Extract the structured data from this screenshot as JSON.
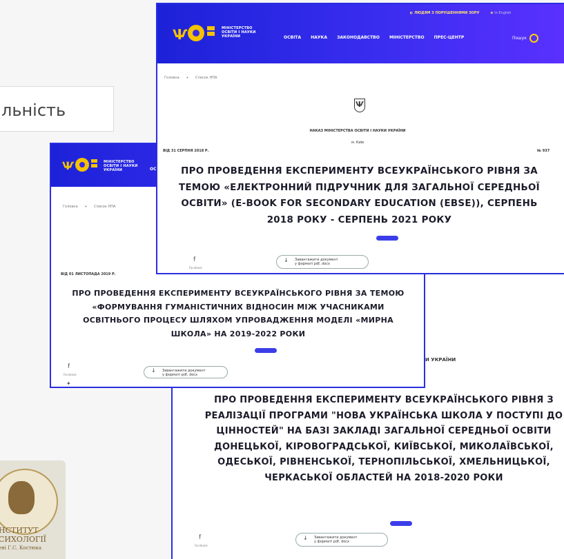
{
  "background": {
    "partial_label": "льність",
    "logo": {
      "line1": "НСТИТУТ",
      "line2": "СИХОЛОГІЇ",
      "line3": "ені Г.С. Костюка"
    }
  },
  "site": {
    "ministry_name": "МІНІСТЕРСТВО ОСВІТИ І НАУКИ УКРАЇНИ",
    "topline": "ЛЮДЯМ З ПОРУШЕННЯМИ ЗОРУ",
    "lang": "In English",
    "nav": [
      "ОСВІТА",
      "НАУКА",
      "ЗАКОНОДАВСТВО",
      "МІНІСТЕРСТВО",
      "ПРЕС-ЦЕНТР"
    ],
    "search_label": "Пошук",
    "crumb_home": "Головна",
    "crumb_sep": "+",
    "crumb_list": "Список НПА",
    "order_label": "НАКАЗ МІНІСТЕРСТВА ОСВІТИ І НАУКИ УКРАЇНИ",
    "city": "м. Київ",
    "download_label": "Завантажити документ",
    "download_sub": "у форматі pdf, docx",
    "facebook": "Facebook"
  },
  "cards": {
    "front": {
      "date": "ВІД 31 СЕРПНЯ 2018 Р.",
      "number": "№ 937",
      "title": "ПРО ПРОВЕДЕННЯ ЕКСПЕРИМЕНТУ ВСЕУКРАЇНСЬКОГО РІВНЯ ЗА ТЕМОЮ «ЕЛЕКТРОННИЙ ПІДРУЧНИК ДЛЯ ЗАГАЛЬНОЇ СЕРЕДНЬОЇ ОСВІТИ» (E-BOOK FOR SECONDARY EDUCATION (EBSE)), СЕРПЕНЬ 2018 РОКУ - СЕРПЕНЬ 2021 РОКУ"
    },
    "middle": {
      "date": "ВІД 01 ЛИСТОПАДА 2019 Р.",
      "title": "ПРО ПРОВЕДЕННЯ ЕКСПЕРИМЕНТУ ВСЕУКРАЇНСЬКОГО РІВНЯ ЗА ТЕМОЮ «ФОРМУВАННЯ ГУМАНІСТИЧНИХ ВІДНОСИН МІЖ УЧАСНИКАМИ ОСВІТНЬОГО ПРОЦЕСУ ШЛЯХОМ УПРОВАДЖЕННЯ МОДЕЛІ «МИРНА ШКОЛА» НА 2019-2022 РОКИ"
    },
    "back": {
      "order_partial": "И УКРАЇНИ",
      "title": "ПРО ПРОВЕДЕННЯ ЕКСПЕРИМЕНТУ ВСЕУКРАЇНСЬКОГО РІВНЯ З РЕАЛІЗАЦІЇ ПРОГРАМИ \"НОВА УКРАЇНСЬКА ШКОЛА У ПОСТУПІ ДО ЦІННОСТЕЙ\" НА БАЗІ ЗАКЛАДІ ЗАГАЛЬНОЇ СЕРЕДНЬОЇ ОСВІТИ ДОНЕЦЬКОЇ, КІРОВОГРАДСЬКОЇ, КИЇВСЬКОЇ, МИКОЛАЇВСЬКОЇ, ОДЕСЬКОЇ, РІВНЕНСЬКОЇ, ТЕРНОПІЛЬСЬКОЇ, ХМЕЛЬНИЦЬКОЇ, ЧЕРКАСЬКОЇ ОБЛАСТЕЙ НА 2018-2020 РОКИ"
    }
  },
  "colors": {
    "header_blue": "#2a28e6",
    "logo_yellow": "#f4c200",
    "badge_blue": "#3b3ee8"
  }
}
